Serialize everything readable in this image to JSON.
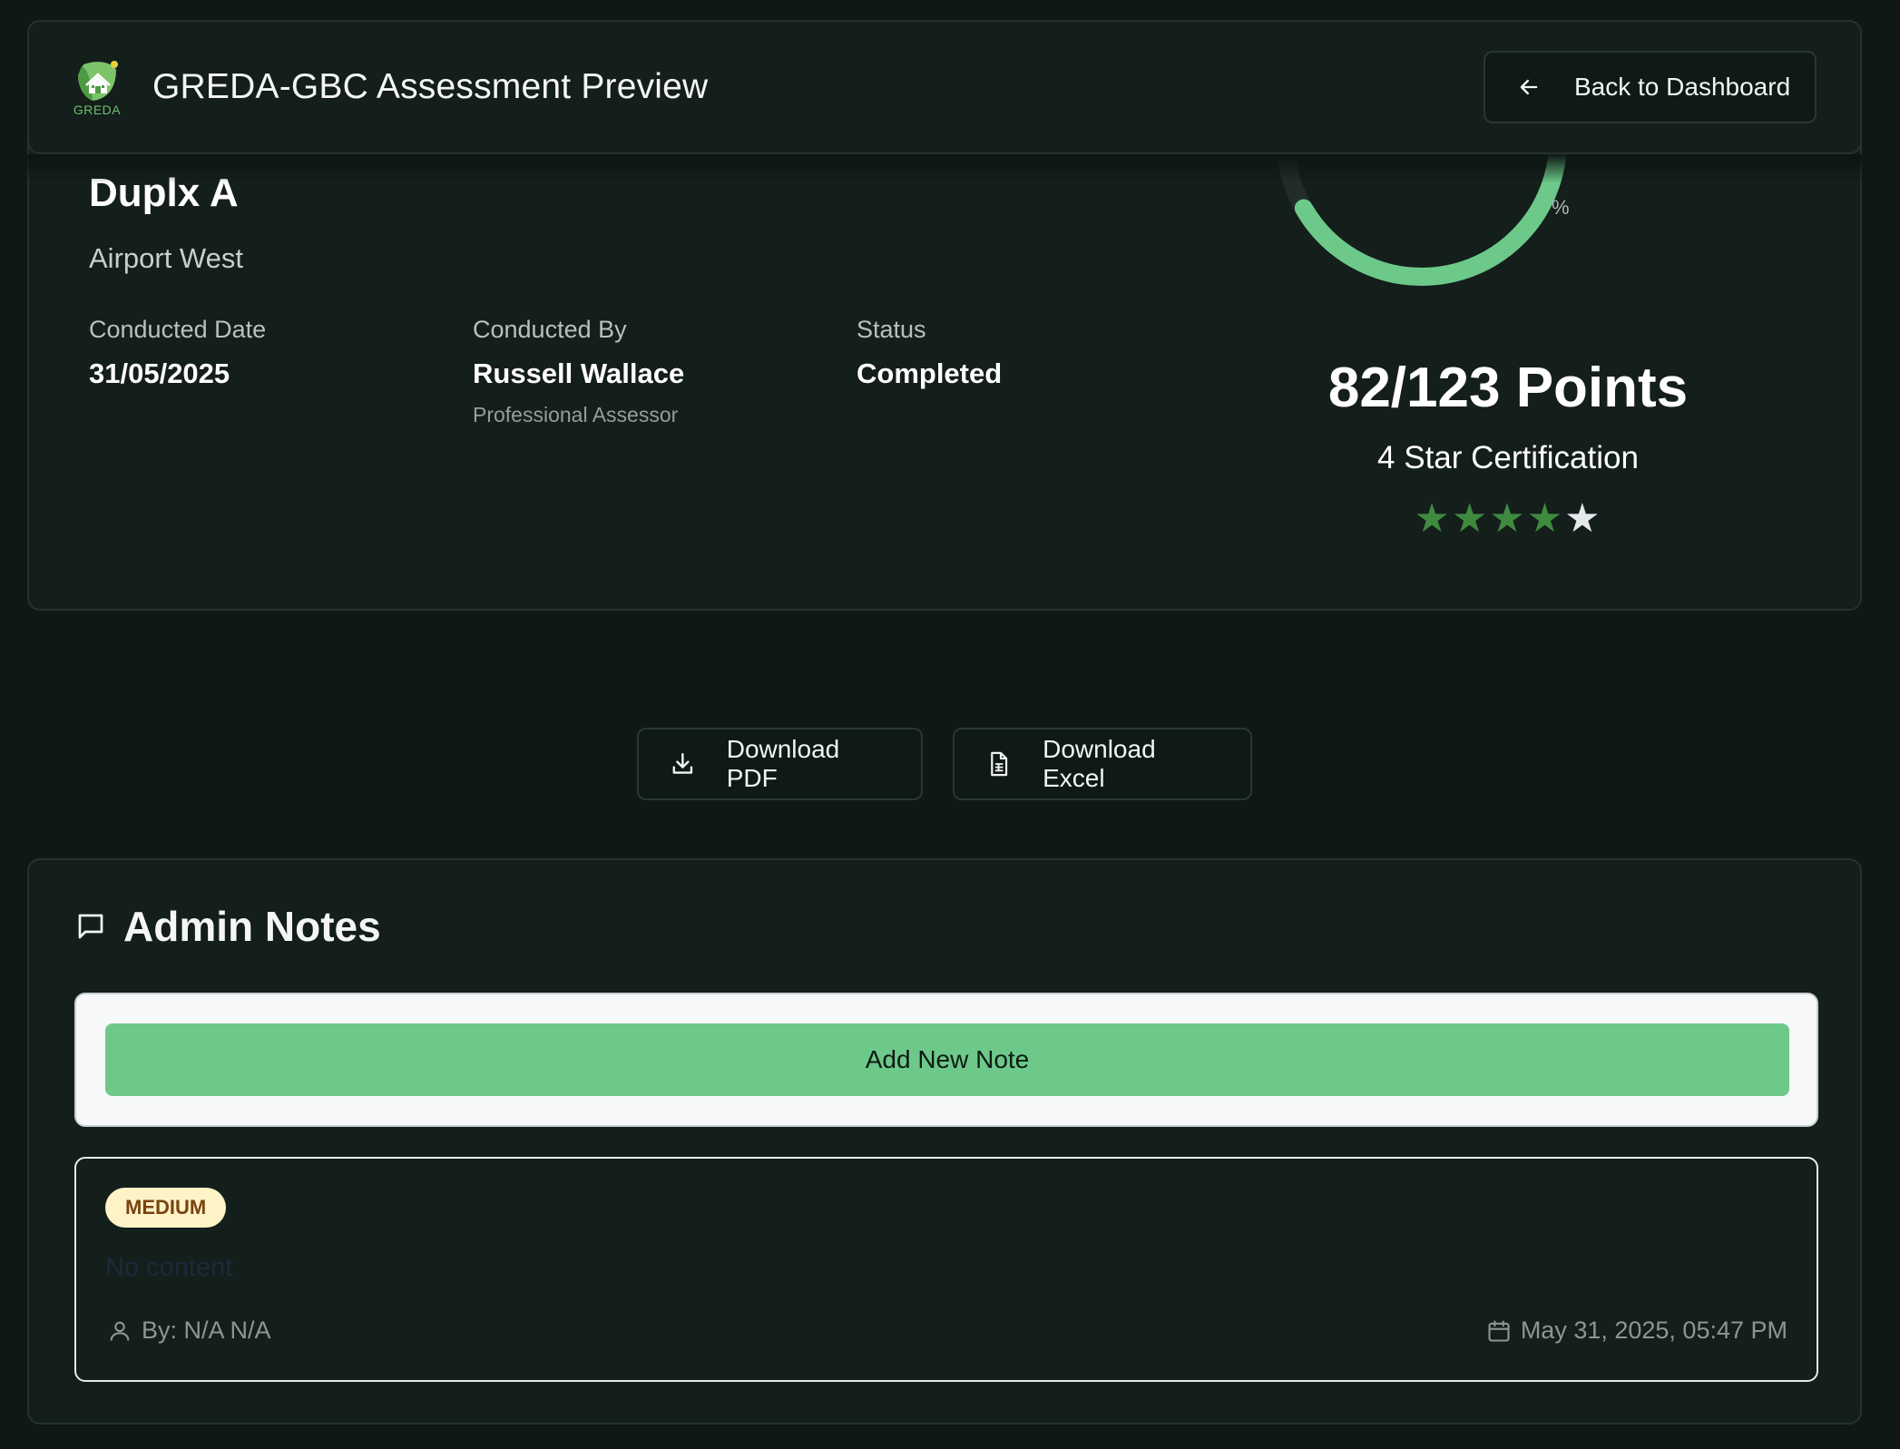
{
  "header": {
    "logo_text": "GREDA",
    "title": "GREDA-GBC Assessment Preview",
    "back_label": "Back to Dashboard"
  },
  "project": {
    "name": "Duplx A",
    "location": "Airport West",
    "conducted_date_label": "Conducted Date",
    "conducted_date": "31/05/2025",
    "conducted_by_label": "Conducted By",
    "conducted_by": "Russell Wallace",
    "conducted_by_role": "Professional Assessor",
    "status_label": "Status",
    "status": "Completed"
  },
  "score": {
    "gauge_unit": "%",
    "gauge_fraction": 0.667,
    "points": "82/123 Points",
    "certification": "4 Star Certification",
    "stars_filled": 4,
    "stars_total": 5,
    "star_glyph": "★",
    "accent": "#6dc98a"
  },
  "downloads": {
    "pdf_label": "Download PDF",
    "excel_label": "Download Excel"
  },
  "notes": {
    "title": "Admin Notes",
    "add_label": "Add New Note",
    "items": [
      {
        "priority": "MEDIUM",
        "content": "No content",
        "author": "By: N/A N/A",
        "date": "May 31, 2025, 05:47 PM"
      }
    ]
  },
  "colors": {
    "background": "#0f1815",
    "card": "#141e1b",
    "accent_green": "#6dc98a",
    "star_on": "#3f8a3f",
    "star_off": "#e4e8ea",
    "badge_bg": "#fdf3c7",
    "badge_text": "#7a4312"
  }
}
